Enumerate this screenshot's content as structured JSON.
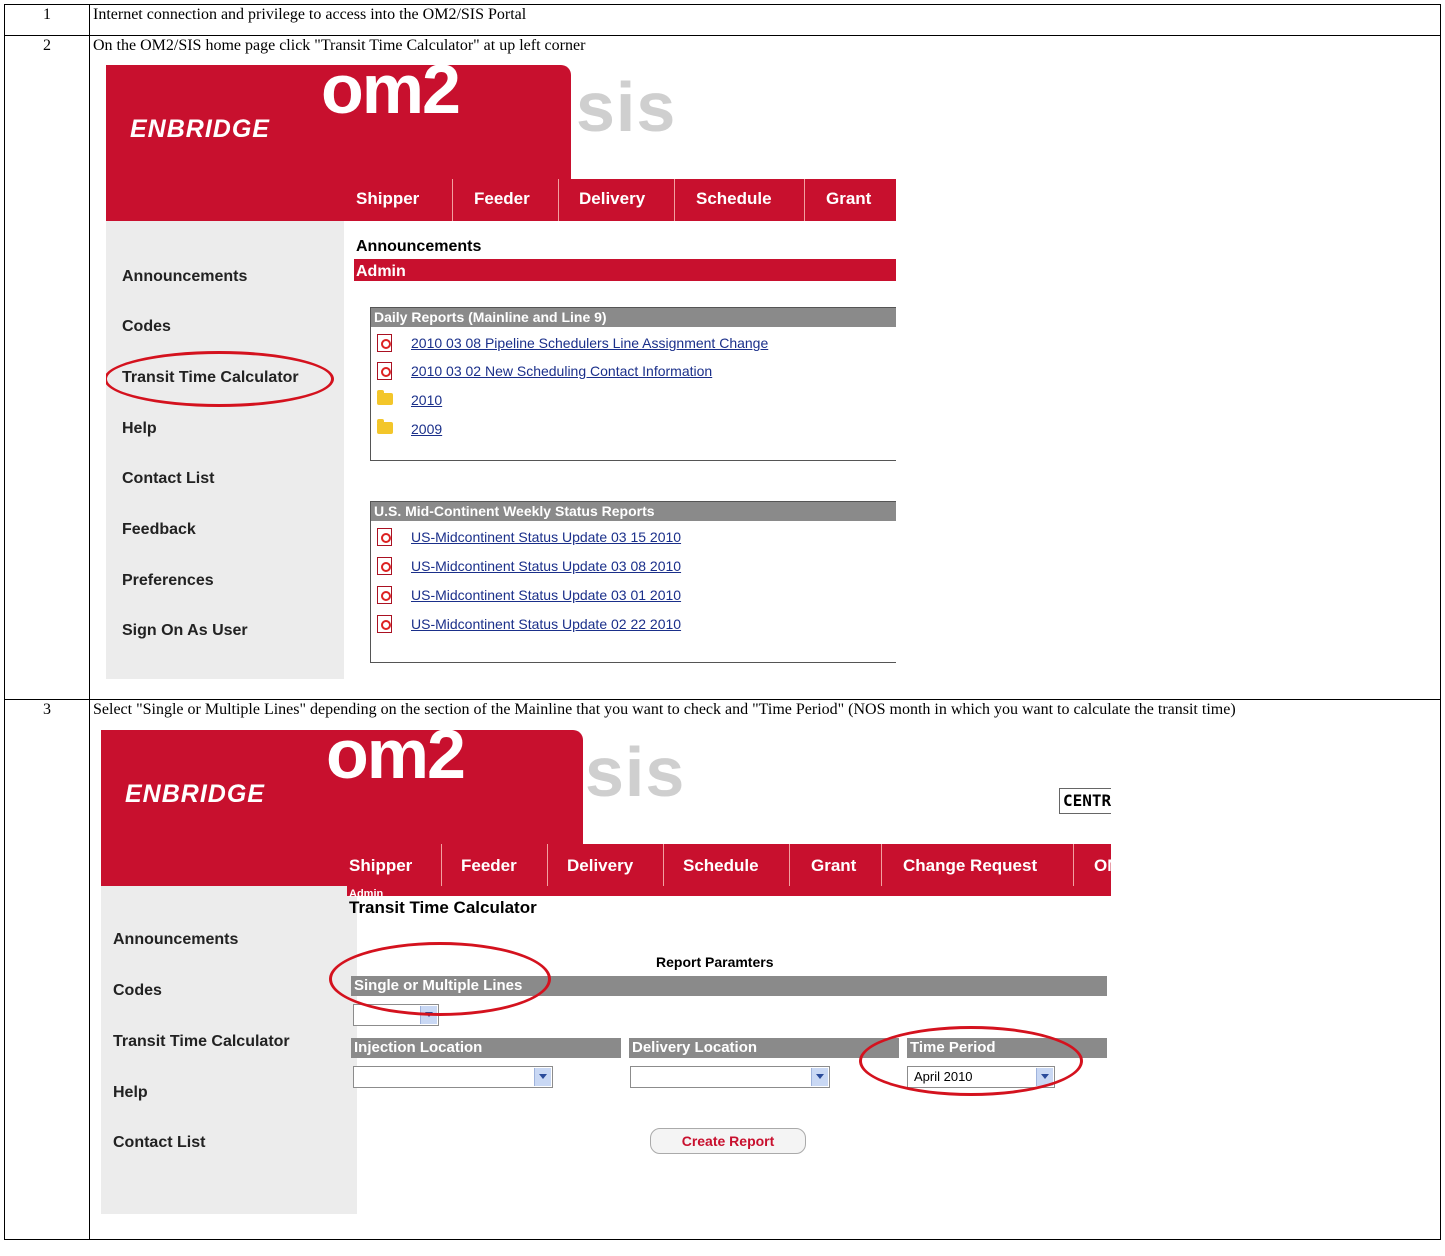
{
  "steps": [
    {
      "num": "1",
      "text": "Internet connection and privilege to access into the OM2/SIS Portal"
    },
    {
      "num": "2",
      "text": "On the OM2/SIS home page click \"Transit Time Calculator\" at up left corner"
    },
    {
      "num": "3",
      "text": "Select \"Single or Multiple Lines\" depending on the section of the Mainline that you want to check and \"Time Period\" (NOS month in which you want to calculate the transit time)"
    }
  ],
  "shot1": {
    "logo": "ENBRIDGE",
    "brand_om2": "om2",
    "brand_sis": "sis",
    "nav": [
      "Shipper",
      "Feeder",
      "Delivery",
      "Schedule",
      "Grant"
    ],
    "sidebar": [
      "Announcements",
      "Codes",
      "Transit Time Calculator",
      "Help",
      "Contact List",
      "Feedback",
      "Preferences",
      "Sign On As User"
    ],
    "announcements_title": "Announcements",
    "admin_label": "Admin",
    "daily_panel": {
      "title": "Daily Reports (Mainline and Line 9)",
      "items": [
        {
          "icon": "pdf-icon",
          "label": "2010 03 08 Pipeline Schedulers Line Assignment Change"
        },
        {
          "icon": "pdf-icon",
          "label": "2010 03 02 New Scheduling Contact Information"
        },
        {
          "icon": "folder-icon",
          "label": "2010"
        },
        {
          "icon": "folder-icon",
          "label": "2009"
        }
      ]
    },
    "weekly_panel": {
      "title": "U.S. Mid-Continent Weekly Status Reports",
      "items": [
        {
          "icon": "pdf-icon",
          "label": "US-Midcontinent Status Update 03 15 2010"
        },
        {
          "icon": "pdf-icon",
          "label": "US-Midcontinent Status Update 03 08 2010"
        },
        {
          "icon": "pdf-icon",
          "label": "US-Midcontinent Status Update 03 01 2010"
        },
        {
          "icon": "pdf-icon",
          "label": "US-Midcontinent Status Update 02 22 2010"
        }
      ]
    }
  },
  "shot2": {
    "logo": "ENBRIDGE",
    "brand_om2": "om2",
    "brand_sis": "sis",
    "centr": "CENTR",
    "nav": [
      "Shipper",
      "Feeder",
      "Delivery",
      "Schedule",
      "Grant",
      "Change Request",
      "OM"
    ],
    "sidebar": [
      "Announcements",
      "Codes",
      "Transit Time Calculator",
      "Help",
      "Contact List"
    ],
    "admin_label": "Admin",
    "page_title": "Transit Time Calculator",
    "report_params": "Report Paramters",
    "single_multiple": "Single or Multiple Lines",
    "injection_location": "Injection Location",
    "delivery_location": "Delivery Location",
    "time_period": "Time Period",
    "time_period_value": "April 2010",
    "create_report": "Create Report"
  }
}
